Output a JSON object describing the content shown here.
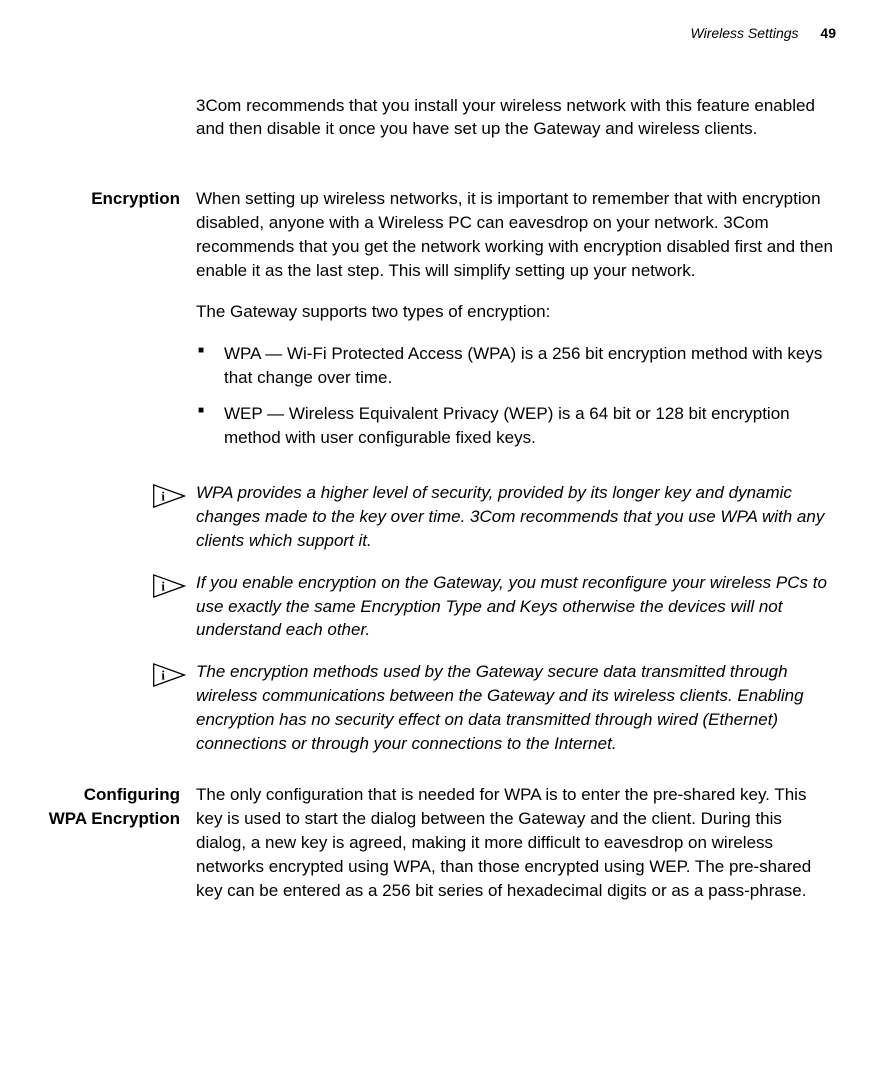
{
  "header": {
    "section": "Wireless Settings",
    "page": "49"
  },
  "intro": {
    "text": "3Com recommends that you install your wireless network with this feature enabled and then disable it once you have set up the Gateway and wireless clients."
  },
  "encryption": {
    "label": "Encryption",
    "p1": "When setting up wireless networks, it is important to remember that with encryption disabled, anyone with a Wireless PC can eavesdrop on your network. 3Com recommends that you get the network working with encryption disabled first and then enable it as the last step. This will simplify setting up your network.",
    "p2": "The Gateway supports two types of encryption:",
    "bullets": [
      "WPA — Wi-Fi Protected Access (WPA) is a 256 bit encryption method with keys that change over time.",
      "WEP — Wireless Equivalent Privacy (WEP) is a 64 bit or 128 bit encryption method with user configurable fixed keys."
    ],
    "notes": [
      "WPA provides a higher level of security, provided by its longer key and dynamic changes made to the key over time. 3Com recommends that you use WPA with any clients which support it.",
      "If you enable encryption on the Gateway, you must reconfigure your wireless PCs to use exactly the same Encryption Type and Keys otherwise the devices will not understand each other.",
      "The encryption methods used by the Gateway secure data transmitted through wireless communications between the Gateway and its wireless clients. Enabling encryption has no security effect on data transmitted through wired (Ethernet) connections or through your connections to the Internet."
    ]
  },
  "wpa": {
    "label": "Configuring WPA Encryption",
    "p1": "The only configuration that is needed for WPA is to enter the pre-shared key. This key is used to start the dialog between the Gateway and the client. During this dialog, a new key is agreed, making it more difficult to eavesdrop on wireless networks encrypted using WPA, than those encrypted using WEP. The pre-shared key can be entered as a 256 bit series of hexadecimal digits or as a pass-phrase."
  }
}
